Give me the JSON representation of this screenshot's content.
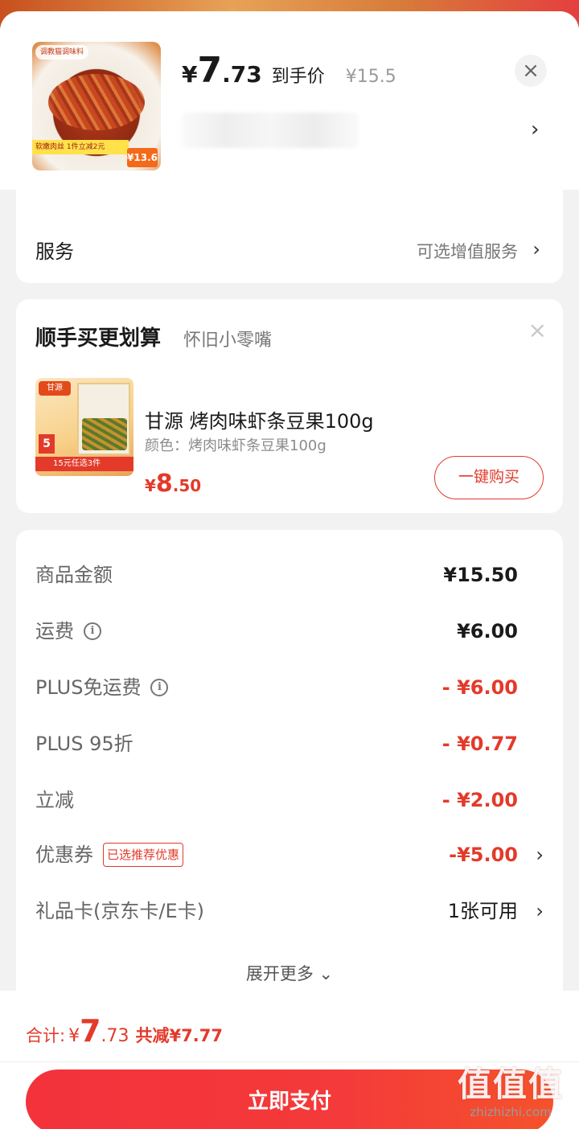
{
  "product": {
    "thumb_brand": "调教猫调味料",
    "thumb_promo": "软嫩肉丝 1件立减2元",
    "thumb_price": "¥13.6",
    "price_symbol": "¥",
    "price_int": "7",
    "price_dec": ".73",
    "price_label": "到手价",
    "original_price": "¥15.5",
    "close_icon": "close-icon",
    "spec_arrow": "›"
  },
  "service": {
    "label": "服务",
    "value": "可选增值服务",
    "arrow": "›"
  },
  "bundle": {
    "title": "顺手买更划算",
    "subtitle": "怀旧小零嘴",
    "close": "×",
    "thumb_logo": "甘源",
    "thumb_num": "5",
    "thumb_band": "15元任选3件",
    "name": "甘源 烤肉味虾条豆果100g",
    "color": "颜色：烤肉味虾条豆果100g",
    "price_symbol": "¥",
    "price_int": "8",
    "price_dec": ".50",
    "buy_label": "一键购买"
  },
  "summary": {
    "rows": [
      {
        "label": "商品金额",
        "value": "¥15.50"
      },
      {
        "label": "运费",
        "value": "¥6.00"
      },
      {
        "label": "PLUS免运费",
        "value": "- ¥6.00"
      },
      {
        "label": "PLUS 95折",
        "value": "- ¥0.77"
      },
      {
        "label": "立减",
        "value": "- ¥2.00"
      },
      {
        "label": "优惠券",
        "badge": "已选推荐优惠",
        "value": "-¥5.00"
      },
      {
        "label": "礼品卡(京东卡/E卡)",
        "value": "1张可用"
      }
    ],
    "expand": "展开更多 ⌄"
  },
  "footer": {
    "total_label": "合计:",
    "total_symbol": "¥",
    "total_int": "7",
    "total_dec": ".73",
    "saved": "共减¥7.77",
    "pay_label": "立即支付",
    "watermark_big": "值值值",
    "watermark_small": "zhizhizhi.com"
  },
  "colors": {
    "accent": "#e33a2a",
    "pay_gradient_start": "#f3323c",
    "pay_gradient_end": "#f5522b"
  }
}
